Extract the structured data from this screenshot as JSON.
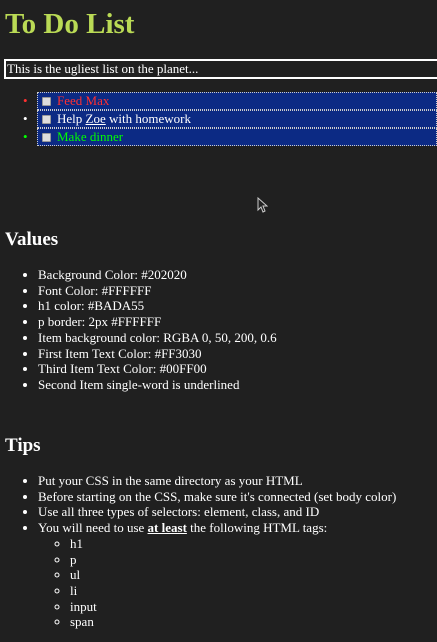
{
  "title": "To Do List",
  "intro": "This is the ugliest list on the planet...",
  "todos": [
    {
      "text": "Feed Max",
      "color": "#FF3030"
    },
    {
      "before": "Help ",
      "underlined": "Zoe",
      "after": " with homework"
    },
    {
      "text": "Make dinner",
      "color": "#00FF00"
    }
  ],
  "values": {
    "heading": "Values",
    "items": [
      "Background Color: #202020",
      "Font Color: #FFFFFF",
      "h1 color: #BADA55",
      "p border: 2px #FFFFFF",
      "Item background color: RGBA 0, 50, 200, 0.6",
      "First Item Text Color: #FF3030",
      "Third Item Text Color: #00FF00",
      "Second Item single-word is underlined"
    ]
  },
  "tips": {
    "heading": "Tips",
    "items": [
      "Put your CSS in the same directory as your HTML",
      "Before starting on the CSS, make sure it's connected (set body color)",
      "Use all three types of selectors: element, class, and ID"
    ],
    "last_before": "You will need to use ",
    "last_bold": "at least",
    "last_after": " the following HTML tags:",
    "tags": [
      "h1",
      "p",
      "ul",
      "li",
      "input",
      "span"
    ]
  }
}
